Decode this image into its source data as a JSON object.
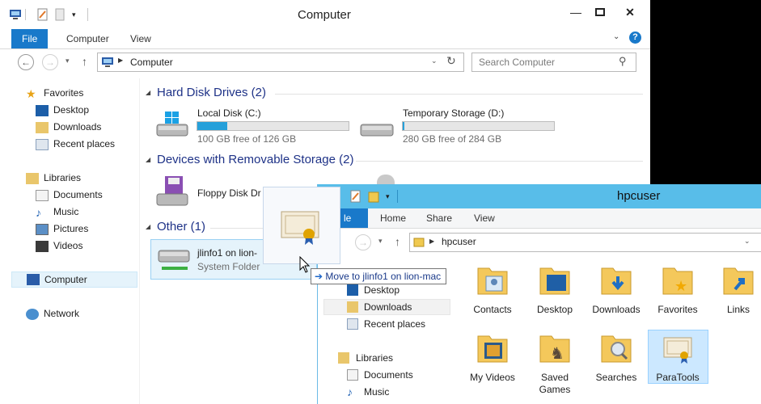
{
  "window1": {
    "title": "Computer",
    "tabs": [
      "File",
      "Computer",
      "View"
    ],
    "address": "Computer",
    "search_placeholder": "Search Computer",
    "nav": {
      "favorites": "Favorites",
      "favorites_items": [
        "Desktop",
        "Downloads",
        "Recent places"
      ],
      "libraries": "Libraries",
      "library_items": [
        "Documents",
        "Music",
        "Pictures",
        "Videos"
      ],
      "computer": "Computer",
      "network": "Network"
    },
    "sections": {
      "hdd": "Hard Disk Drives (2)",
      "removable": "Devices with Removable Storage (2)",
      "other": "Other (1)"
    },
    "drives": [
      {
        "name": "Local Disk (C:)",
        "free": "100 GB free of 126 GB",
        "used_fraction": 0.2
      },
      {
        "name": "Temporary Storage (D:)",
        "free": "280 GB free of 284 GB",
        "used_fraction": 0.01
      }
    ],
    "floppy": "Floppy Disk Dr",
    "other_item": {
      "name": "jlinfo1 on lion-",
      "type": "System Folder"
    }
  },
  "tooltip": "Move to jlinfo1 on lion-mac",
  "window2": {
    "title": "hpcuser",
    "tabs": [
      "le",
      "Home",
      "Share",
      "View"
    ],
    "address": "hpcuser",
    "nav": {
      "desktop": "Desktop",
      "downloads": "Downloads",
      "recent": "Recent places",
      "libraries": "Libraries",
      "documents": "Documents",
      "music": "Music"
    },
    "folders": [
      "Contacts",
      "Desktop",
      "Downloads",
      "Favorites",
      "Links",
      "My Videos",
      "Saved Games",
      "Searches",
      "ParaTools"
    ]
  },
  "colors": {
    "accent": "#1979ca",
    "title2": "#58bde9",
    "section": "#1e3287",
    "fill": "#26a0da"
  }
}
